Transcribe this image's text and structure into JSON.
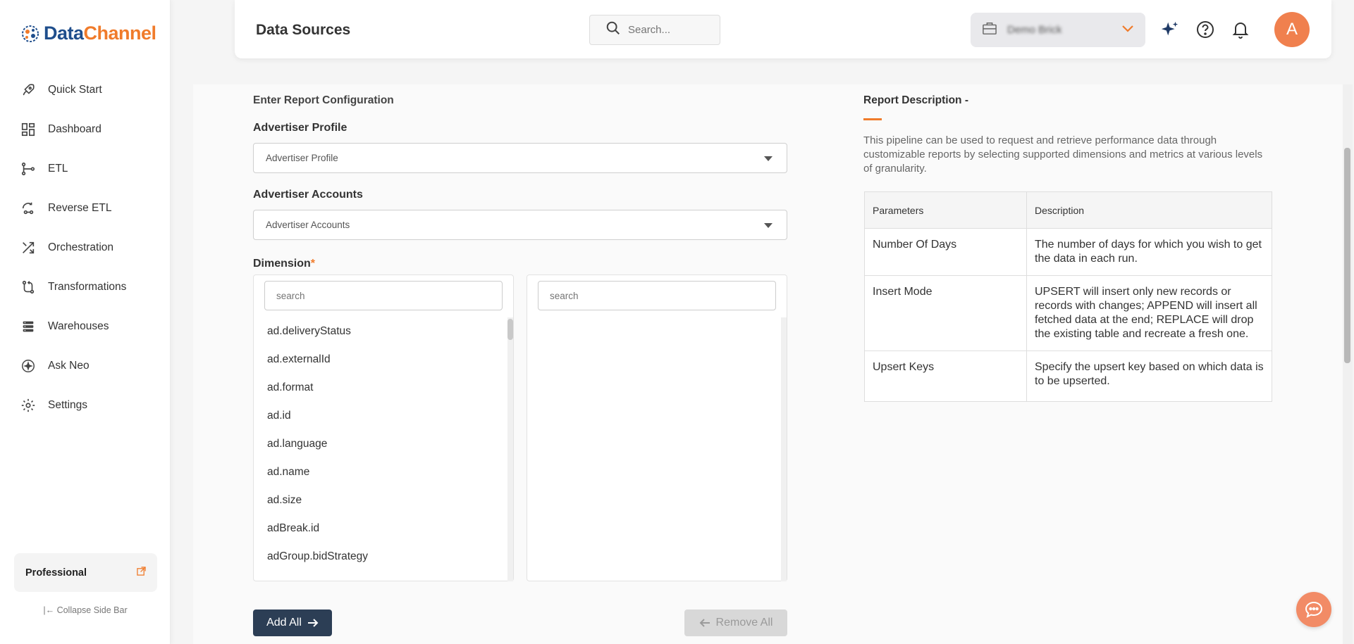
{
  "brand": {
    "part1": "Data",
    "part2": "Channel",
    "color_primary": "#1f4e8c",
    "color_accent": "#f07b2b"
  },
  "sidebar": {
    "items": [
      {
        "label": "Quick Start",
        "icon": "rocket-icon"
      },
      {
        "label": "Dashboard",
        "icon": "dashboard-icon"
      },
      {
        "label": "ETL",
        "icon": "etl-icon"
      },
      {
        "label": "Reverse ETL",
        "icon": "reverse-etl-icon"
      },
      {
        "label": "Orchestration",
        "icon": "orchestration-icon"
      },
      {
        "label": "Transformations",
        "icon": "transformations-icon"
      },
      {
        "label": "Warehouses",
        "icon": "warehouses-icon"
      },
      {
        "label": "Ask Neo",
        "icon": "ask-neo-icon"
      },
      {
        "label": "Settings",
        "icon": "gear-icon"
      }
    ],
    "plan": "Professional",
    "collapse_label": "Collapse Side Bar"
  },
  "header": {
    "title": "Data Sources",
    "search_placeholder": "Search...",
    "account_name": "Demo Brick",
    "avatar_initial": "A"
  },
  "config": {
    "section_title": "Enter Report Configuration",
    "advertiser_profile": {
      "label": "Advertiser Profile",
      "placeholder": "Advertiser Profile"
    },
    "advertiser_accounts": {
      "label": "Advertiser Accounts",
      "placeholder": "Advertiser Accounts"
    },
    "dimension": {
      "label": "Dimension",
      "required_mark": "*",
      "left_search_placeholder": "search",
      "right_search_placeholder": "search",
      "options": [
        "ad.deliveryStatus",
        "ad.externalId",
        "ad.format",
        "ad.id",
        "ad.language",
        "ad.name",
        "ad.size",
        "adBreak.id",
        "adGroup.bidStrategy"
      ]
    },
    "add_all_label": "Add All",
    "remove_all_label": "Remove All"
  },
  "report": {
    "title": "Report Description -",
    "description": "This pipeline can be used to request and retrieve performance data through customizable reports by selecting supported dimensions and metrics at various levels of granularity.",
    "table": {
      "headers": [
        "Parameters",
        "Description"
      ],
      "rows": [
        [
          "Number Of Days",
          "The number of days for which you wish to get the data in each run."
        ],
        [
          "Insert Mode",
          "UPSERT will insert only new records or records with changes; APPEND will insert all fetched data at the end; REPLACE will drop the existing table and recreate a fresh one."
        ],
        [
          "Upsert Keys",
          "Specify the upsert key based on which data is to be upserted."
        ]
      ]
    }
  }
}
